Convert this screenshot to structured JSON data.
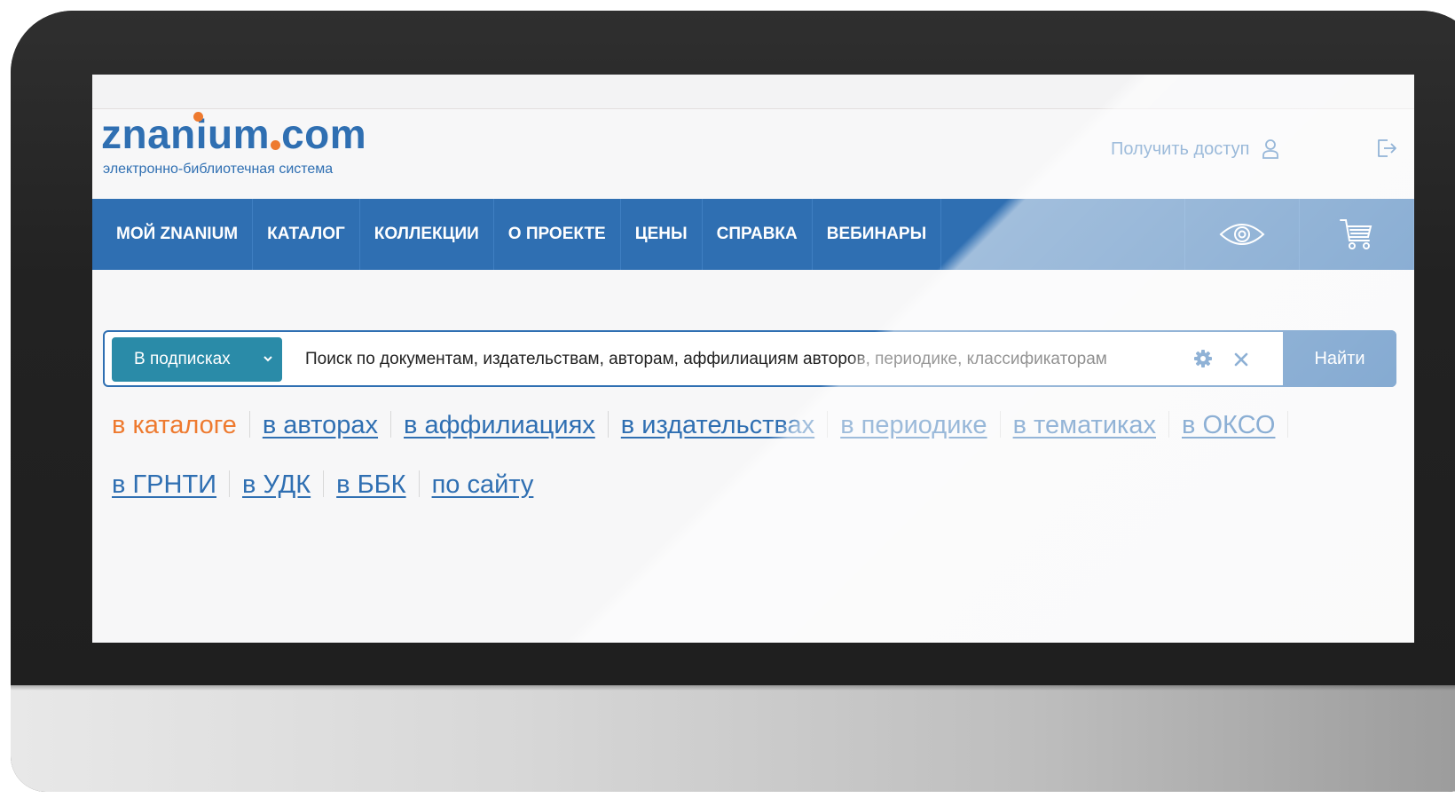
{
  "brand": {
    "name_part1": "znanium",
    "name_part2": "com",
    "subtitle": "электронно-библиотечная система"
  },
  "header": {
    "access_label": "Получить доступ",
    "icons": [
      "user-icon",
      "logout-icon"
    ]
  },
  "nav": {
    "items": [
      "МОЙ ZNANIUM",
      "КАТАЛОГ",
      "КОЛЛЕКЦИИ",
      "О ПРОЕКТЕ",
      "ЦЕНЫ",
      "СПРАВКА",
      "ВЕБИНАРЫ"
    ],
    "icons": [
      "eye-icon",
      "cart-icon"
    ]
  },
  "search": {
    "scope": "В подписках",
    "placeholder": "Поиск по документам, издательствам, авторам, аффилиациям авторов, периодике, классификаторам",
    "button": "Найти"
  },
  "scope_links": {
    "active": "в каталоге",
    "items": [
      "в авторах",
      "в аффилиациях",
      "в издательствах",
      "в периодике",
      "в тематиках",
      "в ОКСО",
      "в ГРНТИ",
      "в УДК",
      "в ББК",
      "по сайту"
    ]
  },
  "colors": {
    "brand_blue": "#2f6fb2",
    "accent_orange": "#ee7a2f",
    "scope_teal": "#2a8ba8"
  }
}
